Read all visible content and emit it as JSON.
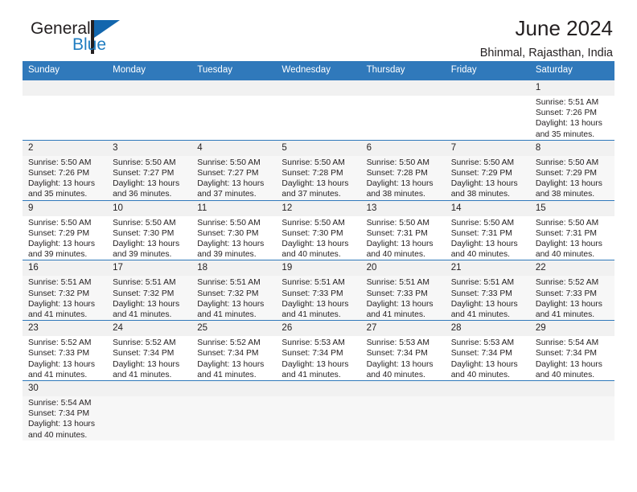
{
  "logo": {
    "word_top": "General",
    "word_bottom": "Blue",
    "triangle_color": "#1266ad",
    "blue_text_color": "#1f7cc0"
  },
  "header": {
    "title": "June 2024",
    "subtitle": "Bhinmal, Rajasthan, India"
  },
  "theme": {
    "header_row_bg": "#3079bb",
    "header_row_text": "#ffffff",
    "cell_border": "#3079bb",
    "daynum_bg": "#f1f1f1",
    "alt_row_bg": "#f7f7f7"
  },
  "calendar": {
    "weekday_headers": [
      "Sunday",
      "Monday",
      "Tuesday",
      "Wednesday",
      "Thursday",
      "Friday",
      "Saturday"
    ],
    "weeks": [
      [
        {
          "day": "",
          "lines": []
        },
        {
          "day": "",
          "lines": []
        },
        {
          "day": "",
          "lines": []
        },
        {
          "day": "",
          "lines": []
        },
        {
          "day": "",
          "lines": []
        },
        {
          "day": "",
          "lines": []
        },
        {
          "day": "1",
          "lines": [
            "Sunrise: 5:51 AM",
            "Sunset: 7:26 PM",
            "Daylight: 13 hours",
            "and 35 minutes."
          ]
        }
      ],
      [
        {
          "day": "2",
          "lines": [
            "Sunrise: 5:50 AM",
            "Sunset: 7:26 PM",
            "Daylight: 13 hours",
            "and 35 minutes."
          ]
        },
        {
          "day": "3",
          "lines": [
            "Sunrise: 5:50 AM",
            "Sunset: 7:27 PM",
            "Daylight: 13 hours",
            "and 36 minutes."
          ]
        },
        {
          "day": "4",
          "lines": [
            "Sunrise: 5:50 AM",
            "Sunset: 7:27 PM",
            "Daylight: 13 hours",
            "and 37 minutes."
          ]
        },
        {
          "day": "5",
          "lines": [
            "Sunrise: 5:50 AM",
            "Sunset: 7:28 PM",
            "Daylight: 13 hours",
            "and 37 minutes."
          ]
        },
        {
          "day": "6",
          "lines": [
            "Sunrise: 5:50 AM",
            "Sunset: 7:28 PM",
            "Daylight: 13 hours",
            "and 38 minutes."
          ]
        },
        {
          "day": "7",
          "lines": [
            "Sunrise: 5:50 AM",
            "Sunset: 7:29 PM",
            "Daylight: 13 hours",
            "and 38 minutes."
          ]
        },
        {
          "day": "8",
          "lines": [
            "Sunrise: 5:50 AM",
            "Sunset: 7:29 PM",
            "Daylight: 13 hours",
            "and 38 minutes."
          ]
        }
      ],
      [
        {
          "day": "9",
          "lines": [
            "Sunrise: 5:50 AM",
            "Sunset: 7:29 PM",
            "Daylight: 13 hours",
            "and 39 minutes."
          ]
        },
        {
          "day": "10",
          "lines": [
            "Sunrise: 5:50 AM",
            "Sunset: 7:30 PM",
            "Daylight: 13 hours",
            "and 39 minutes."
          ]
        },
        {
          "day": "11",
          "lines": [
            "Sunrise: 5:50 AM",
            "Sunset: 7:30 PM",
            "Daylight: 13 hours",
            "and 39 minutes."
          ]
        },
        {
          "day": "12",
          "lines": [
            "Sunrise: 5:50 AM",
            "Sunset: 7:30 PM",
            "Daylight: 13 hours",
            "and 40 minutes."
          ]
        },
        {
          "day": "13",
          "lines": [
            "Sunrise: 5:50 AM",
            "Sunset: 7:31 PM",
            "Daylight: 13 hours",
            "and 40 minutes."
          ]
        },
        {
          "day": "14",
          "lines": [
            "Sunrise: 5:50 AM",
            "Sunset: 7:31 PM",
            "Daylight: 13 hours",
            "and 40 minutes."
          ]
        },
        {
          "day": "15",
          "lines": [
            "Sunrise: 5:50 AM",
            "Sunset: 7:31 PM",
            "Daylight: 13 hours",
            "and 40 minutes."
          ]
        }
      ],
      [
        {
          "day": "16",
          "lines": [
            "Sunrise: 5:51 AM",
            "Sunset: 7:32 PM",
            "Daylight: 13 hours",
            "and 41 minutes."
          ]
        },
        {
          "day": "17",
          "lines": [
            "Sunrise: 5:51 AM",
            "Sunset: 7:32 PM",
            "Daylight: 13 hours",
            "and 41 minutes."
          ]
        },
        {
          "day": "18",
          "lines": [
            "Sunrise: 5:51 AM",
            "Sunset: 7:32 PM",
            "Daylight: 13 hours",
            "and 41 minutes."
          ]
        },
        {
          "day": "19",
          "lines": [
            "Sunrise: 5:51 AM",
            "Sunset: 7:33 PM",
            "Daylight: 13 hours",
            "and 41 minutes."
          ]
        },
        {
          "day": "20",
          "lines": [
            "Sunrise: 5:51 AM",
            "Sunset: 7:33 PM",
            "Daylight: 13 hours",
            "and 41 minutes."
          ]
        },
        {
          "day": "21",
          "lines": [
            "Sunrise: 5:51 AM",
            "Sunset: 7:33 PM",
            "Daylight: 13 hours",
            "and 41 minutes."
          ]
        },
        {
          "day": "22",
          "lines": [
            "Sunrise: 5:52 AM",
            "Sunset: 7:33 PM",
            "Daylight: 13 hours",
            "and 41 minutes."
          ]
        }
      ],
      [
        {
          "day": "23",
          "lines": [
            "Sunrise: 5:52 AM",
            "Sunset: 7:33 PM",
            "Daylight: 13 hours",
            "and 41 minutes."
          ]
        },
        {
          "day": "24",
          "lines": [
            "Sunrise: 5:52 AM",
            "Sunset: 7:34 PM",
            "Daylight: 13 hours",
            "and 41 minutes."
          ]
        },
        {
          "day": "25",
          "lines": [
            "Sunrise: 5:52 AM",
            "Sunset: 7:34 PM",
            "Daylight: 13 hours",
            "and 41 minutes."
          ]
        },
        {
          "day": "26",
          "lines": [
            "Sunrise: 5:53 AM",
            "Sunset: 7:34 PM",
            "Daylight: 13 hours",
            "and 41 minutes."
          ]
        },
        {
          "day": "27",
          "lines": [
            "Sunrise: 5:53 AM",
            "Sunset: 7:34 PM",
            "Daylight: 13 hours",
            "and 40 minutes."
          ]
        },
        {
          "day": "28",
          "lines": [
            "Sunrise: 5:53 AM",
            "Sunset: 7:34 PM",
            "Daylight: 13 hours",
            "and 40 minutes."
          ]
        },
        {
          "day": "29",
          "lines": [
            "Sunrise: 5:54 AM",
            "Sunset: 7:34 PM",
            "Daylight: 13 hours",
            "and 40 minutes."
          ]
        }
      ],
      [
        {
          "day": "30",
          "lines": [
            "Sunrise: 5:54 AM",
            "Sunset: 7:34 PM",
            "Daylight: 13 hours",
            "and 40 minutes."
          ]
        },
        {
          "day": "",
          "lines": []
        },
        {
          "day": "",
          "lines": []
        },
        {
          "day": "",
          "lines": []
        },
        {
          "day": "",
          "lines": []
        },
        {
          "day": "",
          "lines": []
        },
        {
          "day": "",
          "lines": []
        }
      ]
    ]
  }
}
